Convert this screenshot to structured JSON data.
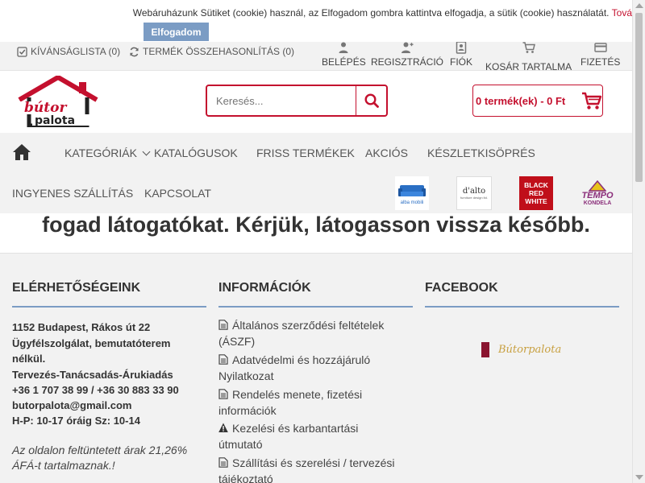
{
  "cookie": {
    "text": "Webáruházunk Sütiket (cookie) használ, az Elfogadom gombra kattintva elfogadja, a sütik (cookie) használatát.",
    "more_link": "Tová",
    "accept_label": "Elfogadom"
  },
  "topbar": {
    "wishlist": "KÍVÁNSÁGLISTA (0)",
    "compare": "TERMÉK ÖSSZEHASONLÍTÁS (0)",
    "items": [
      {
        "label": "BELÉPÉS",
        "icon": "user-icon"
      },
      {
        "label": "REGISZTRÁCIÓ",
        "icon": "add-user-icon"
      },
      {
        "label": "FIÓK",
        "icon": "account-icon"
      },
      {
        "label": "KOSÁR TARTALMA",
        "icon": "cart-icon"
      },
      {
        "label": "FIZETÉS",
        "icon": "credit-card-icon"
      }
    ]
  },
  "logo": {
    "line1": "bútor",
    "line2": "palota"
  },
  "search": {
    "placeholder": "Keresés..."
  },
  "cart": {
    "summary": "0 termék(ek) - 0 Ft"
  },
  "nav": {
    "items": [
      "KATEGÓRIÁK",
      "KATALÓGUSOK",
      "FRISS TERMÉKEK",
      "AKCIÓS",
      "KÉSZLETKISÖPRÉS",
      "INGYENES SZÁLLÍTÁS",
      "KAPCSOLAT"
    ],
    "brands": [
      {
        "name": "alba mobili"
      },
      {
        "name": "d'alto",
        "tagline": "furniture design ltd."
      },
      {
        "name": "BLACK RED WHITE"
      },
      {
        "name": "TEMPO",
        "sub": "KONDELA"
      }
    ]
  },
  "maintenance": {
    "text": "fogad látogatókat. Kérjük, látogasson vissza később."
  },
  "footer": {
    "contact": {
      "title": "ELÉRHETŐSÉGEINK",
      "lines": [
        "1152 Budapest, Rákos út 22",
        "Ügyfélszolgálat, bemutatóterem",
        "nélkül.",
        "Tervezés-Tanácsadás-Árukiadás",
        "+36 1 707 38 99 / +36 30 883 33 90",
        "butorpalota@gmail.com",
        "H-P: 10-17 óráig Sz: 10-14"
      ],
      "vat": [
        "Az oldalon feltüntetett árak 21,26%",
        "ÁFÁ-t tartalmaznak.!"
      ]
    },
    "info": {
      "title": "INFORMÁCIÓK",
      "links": [
        "Általános szerződési feltételek (ÁSZF)",
        "Adatvédelmi és hozzájáruló Nyilatkozat",
        "Rendelés menete, fizetési információk",
        "Kezelési és karbantartási útmutató",
        "Szállítási és szerelési / tervezési tájékoztató"
      ]
    },
    "facebook": {
      "title": "FACEBOOK",
      "page_name": "Bútorpalota"
    }
  },
  "colors": {
    "accent": "#c4102e",
    "blue": "#7b9cc4",
    "bar_bg": "#f2f2f2"
  }
}
